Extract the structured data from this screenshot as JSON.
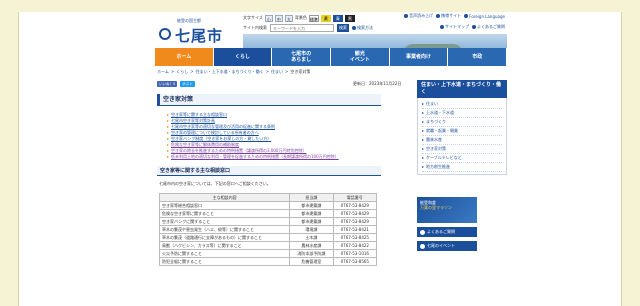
{
  "header": {
    "logo_sub": "能登の国主都",
    "logo_text": "七尾市",
    "text_size_label": "文字サイズ",
    "size_small": "小",
    "size_medium": "中",
    "size_large": "大",
    "color_label": "背景色",
    "color_standard": "標準",
    "color_yellow": "黄",
    "color_blue": "青",
    "color_black": "黒",
    "top_links": [
      "音声読み上げ",
      "携帯サイト",
      "Foreign Language"
    ],
    "search_label": "サイト内検索",
    "search_placeholder": "キーワードを入力",
    "search_button": "検索",
    "search_detail": "検索方法",
    "links_row2": [
      "サイトマップ",
      "よくあるご質問"
    ]
  },
  "nav": [
    {
      "label": "ホーム",
      "kind": "home"
    },
    {
      "label": "くらし",
      "kind": "normal"
    },
    {
      "label": "七尾市の\nあらまし",
      "kind": "normal"
    },
    {
      "label": "観光\nイベント",
      "kind": "normal"
    },
    {
      "label": "事業者向け",
      "kind": "normal"
    },
    {
      "label": "市政",
      "kind": "normal"
    }
  ],
  "breadcrumb": [
    "ホーム",
    "くらし",
    "住まい・上下水道・まちづくり・働く",
    "住まい",
    "空き家対策"
  ],
  "social": {
    "facebook": "いいね！0",
    "twitter": "ポスト"
  },
  "updated": "更新日：2023年11月22日",
  "main": {
    "title": "空き家対策",
    "links": [
      {
        "text": "空き家等に関する主な相談窓口",
        "visited": false
      },
      {
        "text": "七尾市空き家等対策計画",
        "visited": false
      },
      {
        "text": "七尾市空き家等の適切な管理及び活用の促進に関する条例",
        "visited": false
      },
      {
        "text": "空き家の管理について検討している所有者の方へ",
        "visited": false
      },
      {
        "text": "空き家バンク制度（空き家をお探しの方・貸したい方）",
        "visited": false
      },
      {
        "text": "危険な空き家等に解体費用の補助制度",
        "visited": true
      },
      {
        "text": "空き家の除去を推進するための特例措置（譲渡所得の3,000万円特別控除）",
        "visited": true
      },
      {
        "text": "低未利用土地の適切な利用・管理を促進するための特例措置（長期譲渡所得の100万円控除）",
        "visited": true
      }
    ],
    "section_title": "空き家等に関する主な相談窓口",
    "section_desc": "七尾市内の空き家については、下記の窓口へご相談ください。",
    "table": {
      "headers": [
        "主な相談内容",
        "担当課",
        "電話番号"
      ],
      "rows": [
        [
          "空き家等総合相談窓口",
          "都市建築課",
          "0767-53-8429"
        ],
        [
          "危険な空き家等に関すること",
          "都市建築課",
          "0767-53-8429"
        ],
        [
          "空き家バンクに関すること",
          "都市建築課",
          "0767-53-8429"
        ],
        [
          "草木の繁茂や害虫発生（ハエ、蚊等）に関すること",
          "環境課",
          "0767-53-8421"
        ],
        [
          "草木の繁茂（道路通行に支障があるもの）に関すること",
          "土木課",
          "0767-53-8425"
        ],
        [
          "鳥獣（ハクビシン、カラス等）に関すること",
          "農林水産課",
          "0767-53-8422"
        ],
        [
          "火災予防に関すること",
          "消防本部予防課",
          "0767-53-1016"
        ],
        [
          "防犯全般に関すること",
          "危機管理室",
          "0767-53-8565"
        ]
      ]
    }
  },
  "sidebar": {
    "head": "住まい・上下水道・まちづくり・働く",
    "items": [
      "住まい",
      "上水道・下水道",
      "まちづくり",
      "就職・起業・開業",
      "農林水産",
      "空き家対策",
      "ケーブルテレビなど",
      "地方創生推進"
    ],
    "marathon_title": "能登和倉",
    "marathon_sub": "万葉の里マラソン",
    "btn_faq": "よくあるご質問",
    "btn_event": "七尾のイベント"
  }
}
